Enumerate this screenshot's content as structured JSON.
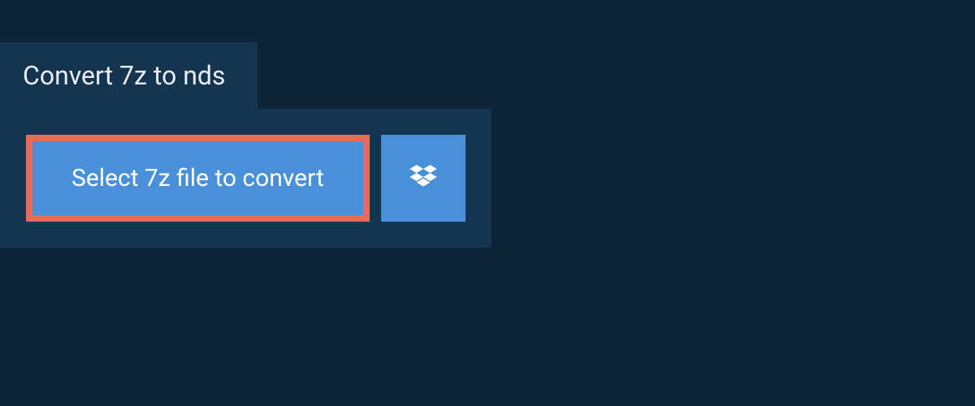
{
  "header": {
    "title": "Convert 7z to nds"
  },
  "actions": {
    "select_label": "Select 7z file to convert",
    "dropbox_icon": "dropbox-icon"
  },
  "colors": {
    "accent": "#4a90d9",
    "highlight_border": "#e86a5c",
    "panel_bg": "#14344f",
    "page_bg": "#0d2438"
  }
}
